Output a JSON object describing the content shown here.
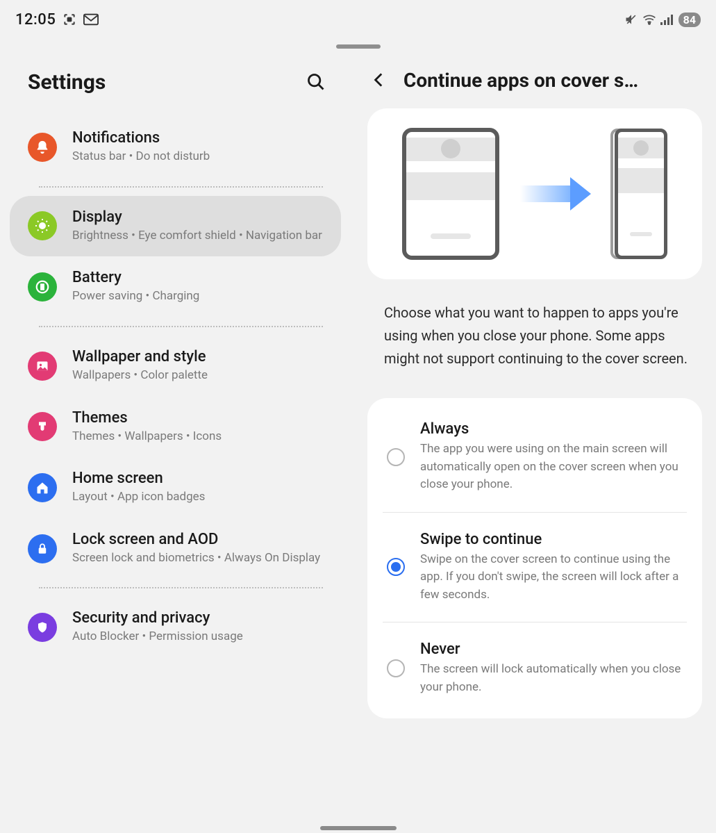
{
  "status": {
    "time": "12:05",
    "battery": "84"
  },
  "left": {
    "title": "Settings",
    "items": [
      {
        "title": "Notifications",
        "sub": "Status bar  •  Do not disturb",
        "icon": "bell",
        "color": "#e8572a"
      },
      {
        "title": "Display",
        "sub": "Brightness  •  Eye comfort shield  •  Navigation bar",
        "icon": "sun",
        "color": "#8bc926",
        "selected": true
      },
      {
        "title": "Battery",
        "sub": "Power saving  •  Charging",
        "icon": "battery",
        "color": "#2bb33b"
      },
      {
        "title": "Wallpaper and style",
        "sub": "Wallpapers  •  Color palette",
        "icon": "image",
        "color": "#e23b74"
      },
      {
        "title": "Themes",
        "sub": "Themes  •  Wallpapers  •  Icons",
        "icon": "brush",
        "color": "#e23b74"
      },
      {
        "title": "Home screen",
        "sub": "Layout  •  App icon badges",
        "icon": "home",
        "color": "#2c6ef0"
      },
      {
        "title": "Lock screen and AOD",
        "sub": "Screen lock and biometrics  •  Always On Display",
        "icon": "lock",
        "color": "#2c6ef0"
      },
      {
        "title": "Security and privacy",
        "sub": "Auto Blocker  •  Permission usage",
        "icon": "shield",
        "color": "#7a3de0"
      }
    ]
  },
  "right": {
    "title": "Continue apps on cover s…",
    "description": "Choose what you want to happen to apps you're using when you close your phone. Some apps might not support continuing to the cover screen.",
    "options": [
      {
        "title": "Always",
        "desc": "The app you were using on the main screen will automatically open on the cover screen when you close your phone.",
        "checked": false
      },
      {
        "title": "Swipe to continue",
        "desc": "Swipe on the cover screen to continue using the app. If you don't swipe, the screen will lock after a few seconds.",
        "checked": true
      },
      {
        "title": "Never",
        "desc": "The screen will lock automatically when you close your phone.",
        "checked": false
      }
    ]
  }
}
